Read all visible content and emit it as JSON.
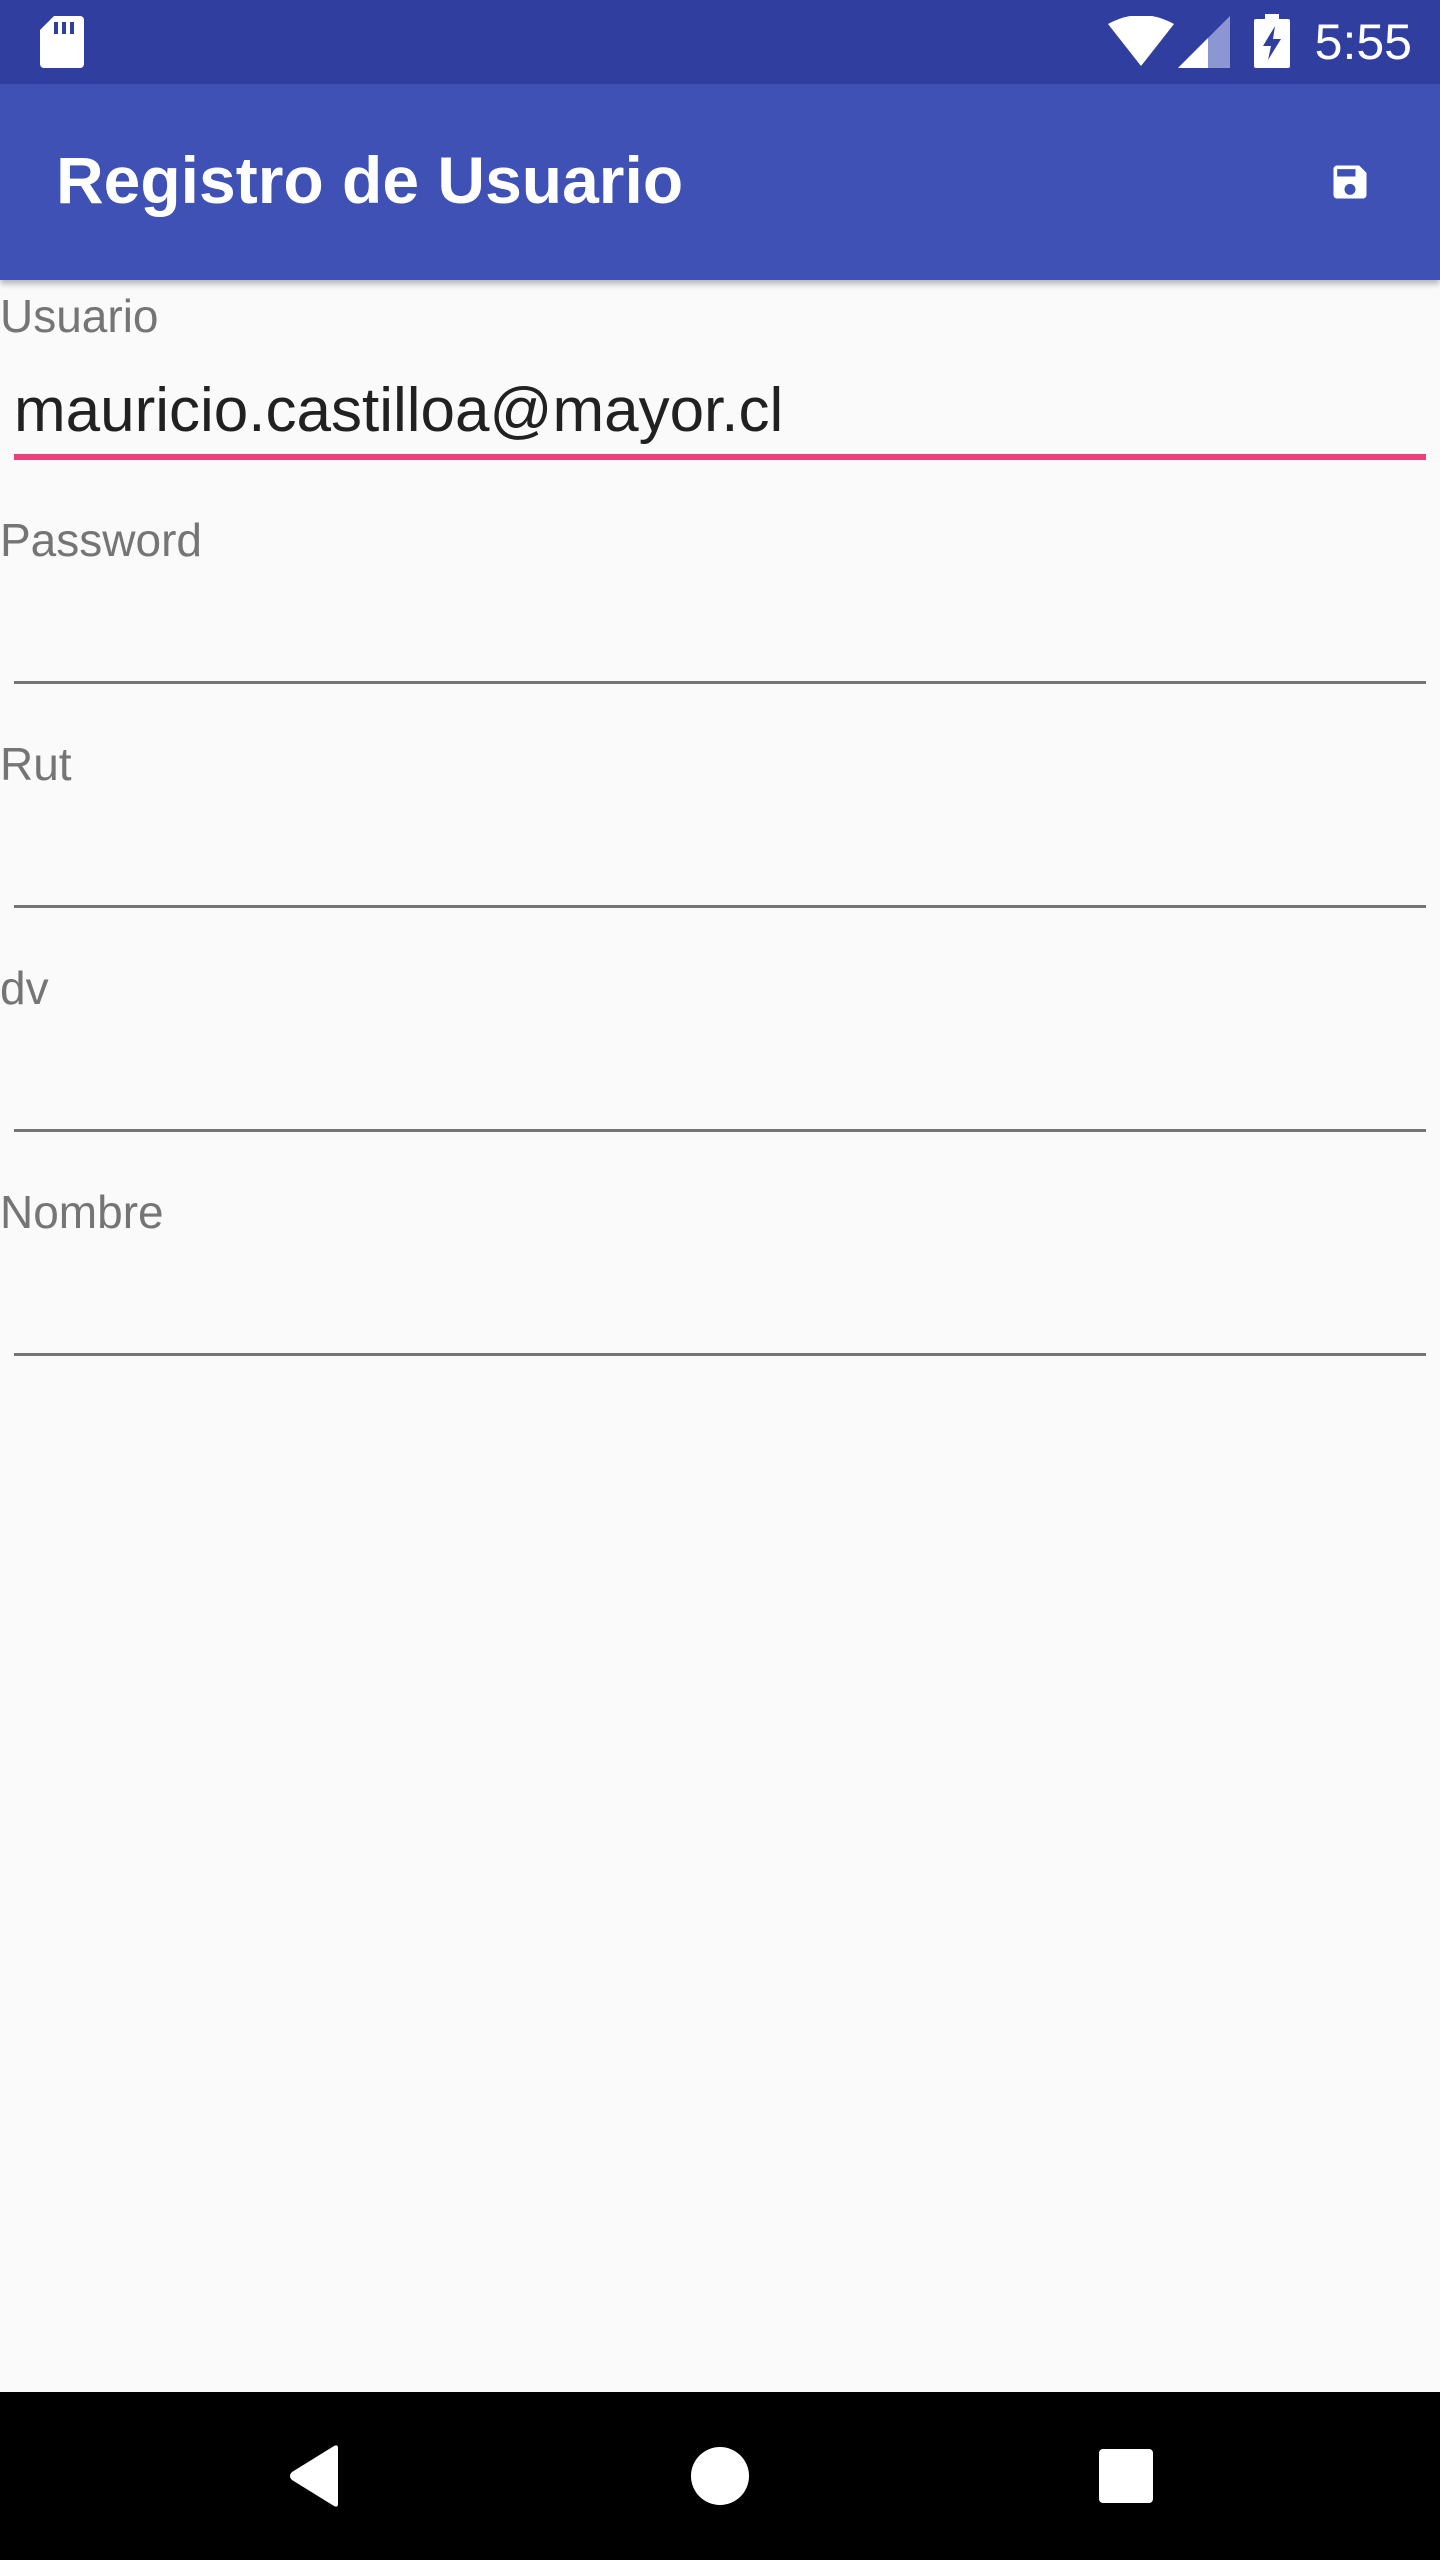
{
  "status_bar": {
    "time": "5:55",
    "icons": [
      "sd-card-icon",
      "wifi-icon",
      "cell-signal-icon",
      "battery-charging-icon"
    ]
  },
  "app_bar": {
    "title": "Registro de Usuario",
    "action_icon": "save-icon",
    "color": "#3f51b5",
    "status_color": "#303f9f"
  },
  "form": {
    "fields": [
      {
        "label": "Usuario",
        "value": "mauricio.castilloa@mayor.cl",
        "focused": true
      },
      {
        "label": "Password",
        "value": ""
      },
      {
        "label": "Rut",
        "value": ""
      },
      {
        "label": "dv",
        "value": ""
      },
      {
        "label": "Nombre",
        "value": ""
      }
    ],
    "accent_color": "#ec407a"
  },
  "nav_bar": {
    "buttons": [
      "back-icon",
      "home-icon",
      "recents-icon"
    ]
  }
}
